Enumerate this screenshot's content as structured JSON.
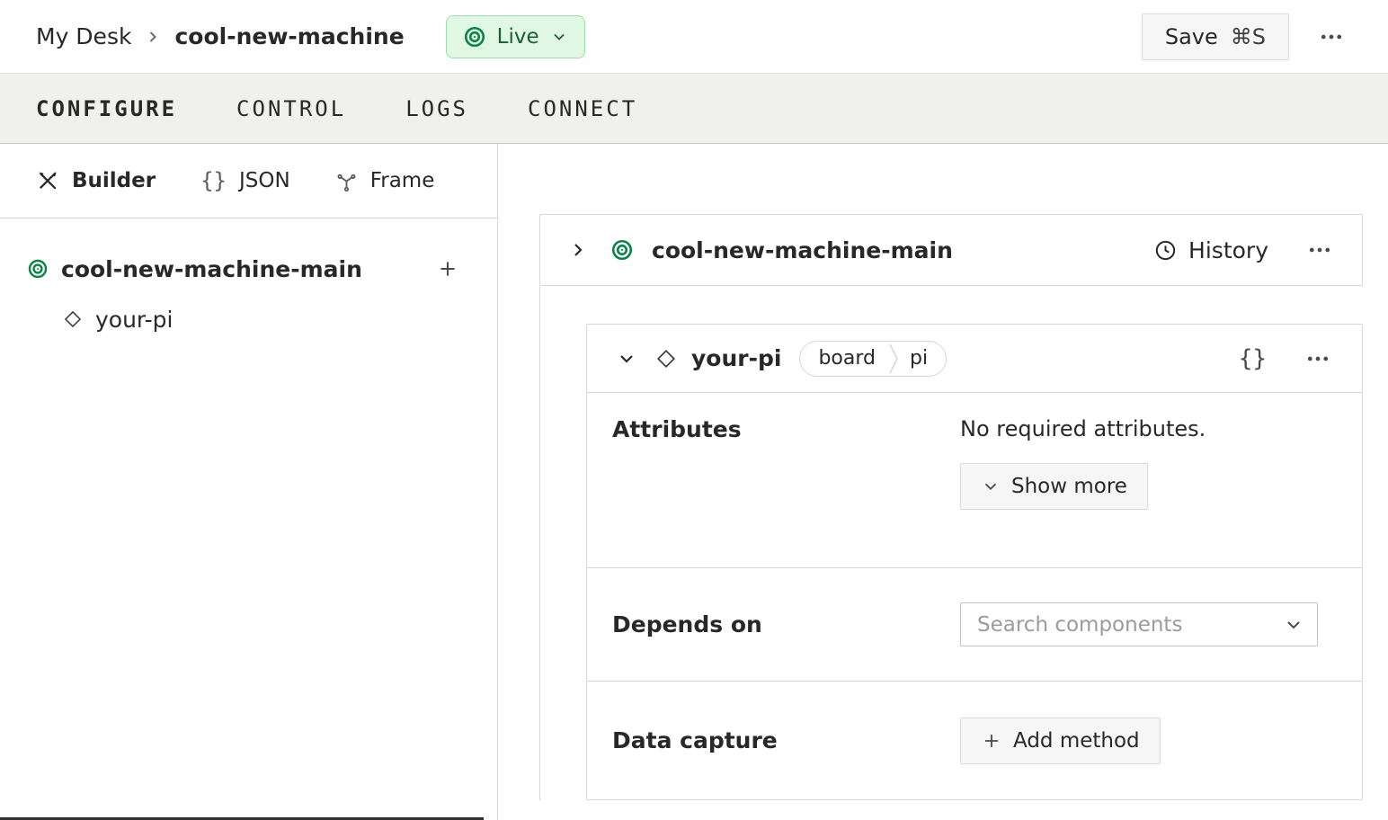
{
  "header": {
    "breadcrumb": {
      "root": "My Desk",
      "current": "cool-new-machine"
    },
    "live_badge": {
      "label": "Live"
    },
    "save_button": {
      "label": "Save",
      "shortcut": "⌘S"
    }
  },
  "tabs": [
    {
      "label": "CONFIGURE",
      "active": true
    },
    {
      "label": "CONTROL",
      "active": false
    },
    {
      "label": "LOGS",
      "active": false
    },
    {
      "label": "CONNECT",
      "active": false
    }
  ],
  "sidebar": {
    "modes": [
      {
        "label": "Builder",
        "active": true
      },
      {
        "label": "JSON",
        "active": false
      },
      {
        "label": "Frame",
        "active": false
      }
    ],
    "tree": {
      "machine_name": "cool-new-machine-main",
      "components": [
        "your-pi"
      ]
    }
  },
  "main": {
    "part_card": {
      "title": "cool-new-machine-main",
      "history_label": "History"
    },
    "component_card": {
      "name": "your-pi",
      "badges": [
        "board",
        "pi"
      ],
      "attributes": {
        "label": "Attributes",
        "empty_text": "No required attributes.",
        "show_more_label": "Show more"
      },
      "depends_on": {
        "label": "Depends on",
        "placeholder": "Search components"
      },
      "data_capture": {
        "label": "Data capture",
        "add_method_label": "Add method"
      }
    }
  },
  "icons": {
    "braces": "{}"
  },
  "colors": {
    "accent-green": "#0c8346",
    "live-bg": "#e0f8e3",
    "live-border": "#9fdcab",
    "live-text": "#1a5d33",
    "border": "#d7d7d7",
    "tabbar-bg": "#f0f0ef",
    "button-bg": "#f6f6f6",
    "text": "#282828",
    "muted-text": "#9b9b9b"
  }
}
